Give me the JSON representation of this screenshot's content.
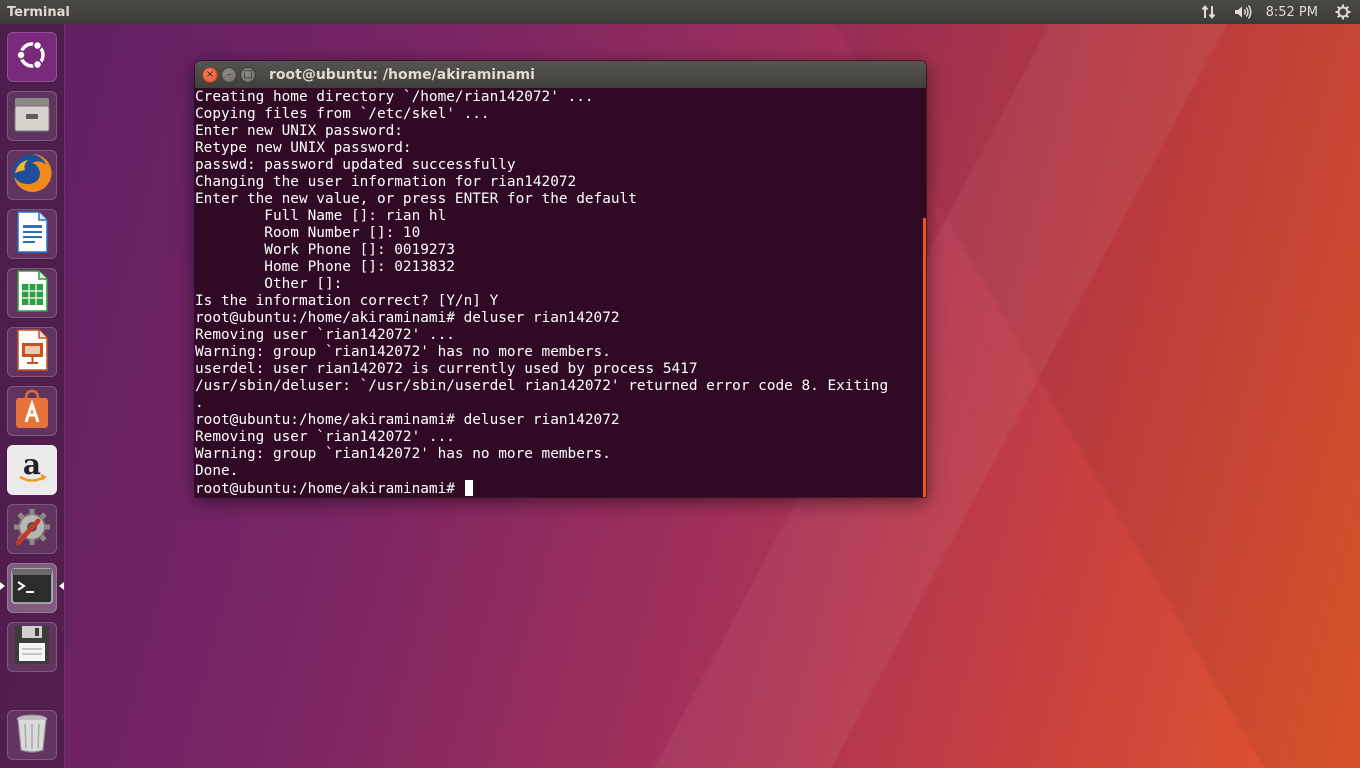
{
  "top_panel": {
    "app_title": "Terminal",
    "network_icon": "network-updown-icon",
    "volume_icon": "volume-icon",
    "clock": "8:52 PM",
    "settings_icon": "power-gear-icon"
  },
  "launcher": {
    "items": [
      {
        "name": "ubuntu-dash",
        "icon": "ubuntu-logo-icon"
      },
      {
        "name": "files",
        "icon": "files-drawer-icon"
      },
      {
        "name": "firefox",
        "icon": "firefox-icon"
      },
      {
        "name": "libreoffice-writer",
        "icon": "writer-icon"
      },
      {
        "name": "libreoffice-calc",
        "icon": "calc-icon"
      },
      {
        "name": "libreoffice-impress",
        "icon": "impress-icon"
      },
      {
        "name": "ubuntu-software",
        "icon": "software-bag-icon"
      },
      {
        "name": "amazon",
        "icon": "amazon-icon"
      },
      {
        "name": "system-settings",
        "icon": "settings-wrench-icon"
      },
      {
        "name": "terminal",
        "icon": "terminal-icon"
      },
      {
        "name": "disk-save",
        "icon": "floppy-icon"
      },
      {
        "name": "trash",
        "icon": "trash-icon"
      }
    ]
  },
  "window": {
    "title": "root@ubuntu: /home/akiraminami",
    "close_glyph": "×",
    "min_glyph": "–",
    "max_glyph": "□"
  },
  "terminal": {
    "lines": [
      "Creating home directory `/home/rian142072' ...",
      "Copying files from `/etc/skel' ...",
      "Enter new UNIX password:",
      "Retype new UNIX password:",
      "passwd: password updated successfully",
      "Changing the user information for rian142072",
      "Enter the new value, or press ENTER for the default",
      "        Full Name []: rian hl",
      "        Room Number []: 10",
      "        Work Phone []: 0019273",
      "        Home Phone []: 0213832",
      "        Other []:",
      "Is the information correct? [Y/n] Y",
      "root@ubuntu:/home/akiraminami# deluser rian142072",
      "Removing user `rian142072' ...",
      "Warning: group `rian142072' has no more members.",
      "userdel: user rian142072 is currently used by process 5417",
      "/usr/sbin/deluser: `/usr/sbin/userdel rian142072' returned error code 8. Exiting",
      ".",
      "root@ubuntu:/home/akiraminami# deluser rian142072",
      "Removing user `rian142072' ...",
      "Warning: group `rian142072' has no more members.",
      "Done."
    ],
    "prompt": "root@ubuntu:/home/akiraminami# "
  },
  "colors": {
    "terminal_bg": "#300a24",
    "accent_orange": "#e95420",
    "panel_bg": "#3c3b37"
  }
}
